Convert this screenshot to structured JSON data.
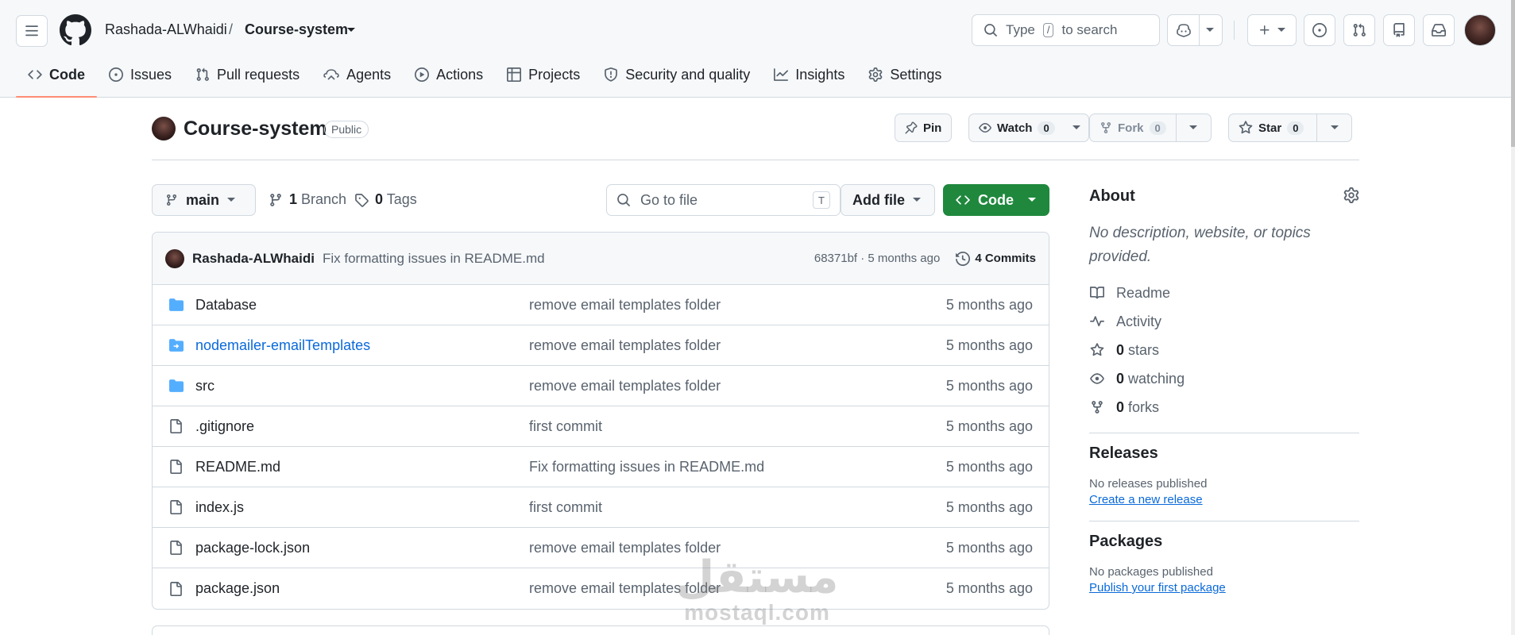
{
  "header": {
    "owner": "Rashada-ALWhaidi",
    "separator": "/",
    "repo": "Course-system",
    "search_prefix": "Type",
    "search_key": "/",
    "search_suffix": "to search"
  },
  "tabs": [
    {
      "label": "Code",
      "icon": "code-icon",
      "active": true
    },
    {
      "label": "Issues",
      "icon": "issue-icon"
    },
    {
      "label": "Pull requests",
      "icon": "pull-request-icon"
    },
    {
      "label": "Agents",
      "icon": "agents-icon"
    },
    {
      "label": "Actions",
      "icon": "play-icon"
    },
    {
      "label": "Projects",
      "icon": "table-icon"
    },
    {
      "label": "Security and quality",
      "icon": "shield-icon"
    },
    {
      "label": "Insights",
      "icon": "graph-icon"
    },
    {
      "label": "Settings",
      "icon": "gear-icon"
    }
  ],
  "repo": {
    "title": "Course-system",
    "visibility": "Public",
    "pin_label": "Pin",
    "watch_label": "Watch",
    "watch_count": "0",
    "fork_label": "Fork",
    "fork_count": "0",
    "star_label": "Star",
    "star_count": "0"
  },
  "toolbar": {
    "branch": "main",
    "branches_count": "1",
    "branches_label": "Branch",
    "tags_count": "0",
    "tags_label": "Tags",
    "goto_placeholder": "Go to file",
    "goto_key": "T",
    "add_file": "Add file",
    "code_button": "Code"
  },
  "latest_commit": {
    "author": "Rashada-ALWhaidi",
    "message": "Fix formatting issues in README.md",
    "sha_time": "68371bf · 5 months ago",
    "commits_label": "4 Commits"
  },
  "files": [
    {
      "name": "Database",
      "type": "folder",
      "message": "remove email templates folder",
      "age": "5 months ago"
    },
    {
      "name": "nodemailer-emailTemplates",
      "type": "submodule",
      "message": "remove email templates folder",
      "age": "5 months ago"
    },
    {
      "name": "src",
      "type": "folder",
      "message": "remove email templates folder",
      "age": "5 months ago"
    },
    {
      "name": ".gitignore",
      "type": "file",
      "message": "first commit",
      "age": "5 months ago"
    },
    {
      "name": "README.md",
      "type": "file",
      "message": "Fix formatting issues in README.md",
      "age": "5 months ago"
    },
    {
      "name": "index.js",
      "type": "file",
      "message": "first commit",
      "age": "5 months ago"
    },
    {
      "name": "package-lock.json",
      "type": "file",
      "message": "remove email templates folder",
      "age": "5 months ago"
    },
    {
      "name": "package.json",
      "type": "file",
      "message": "remove email templates folder",
      "age": "5 months ago"
    }
  ],
  "about": {
    "title": "About",
    "description": "No description, website, or topics provided.",
    "readme": "Readme",
    "activity": "Activity",
    "stars_count": "0",
    "stars_label": "stars",
    "watching_count": "0",
    "watching_label": "watching",
    "forks_count": "0",
    "forks_label": "forks"
  },
  "releases": {
    "title": "Releases",
    "empty": "No releases published",
    "link": "Create a new release"
  },
  "packages": {
    "title": "Packages",
    "empty": "No packages published",
    "link": "Publish your first package"
  },
  "watermark": {
    "arabic": "مستقل",
    "latin": "mostaql.com"
  },
  "colors": {
    "accent_green": "#1f883d",
    "link_blue": "#0969da",
    "folder_blue": "#54aeff",
    "active_tab_underline": "#fd8c73"
  }
}
